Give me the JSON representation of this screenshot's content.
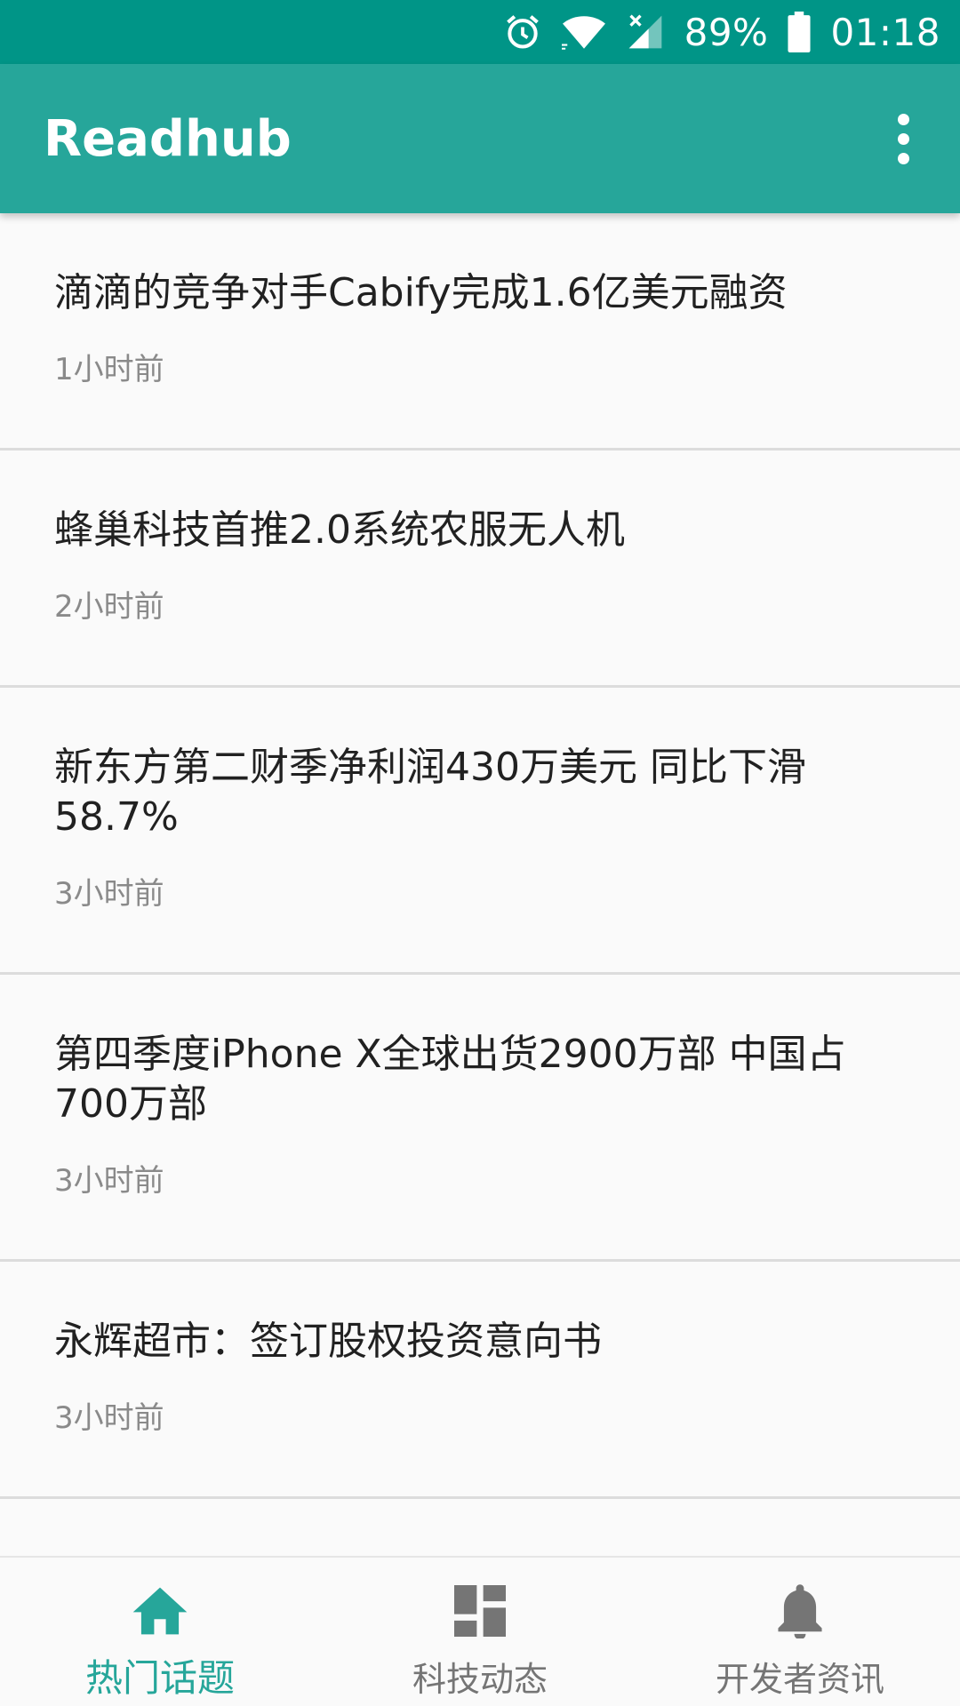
{
  "colors": {
    "status_bar": "#009587",
    "app_bar": "#26a69a",
    "accent": "#26a69a",
    "inactive": "#757575"
  },
  "status_bar": {
    "icons": [
      "alarm-icon",
      "wifi-icon",
      "cell-signal-icon",
      "battery-icon"
    ],
    "battery": "89%",
    "time": "01:18"
  },
  "app_bar": {
    "title": "Readhub",
    "menu_icon": "overflow-menu-icon"
  },
  "feed": {
    "items": [
      {
        "title": "滴滴的竞争对手Cabify完成1.6亿美元融资",
        "time": "1小时前"
      },
      {
        "title": "蜂巢科技首推2.0系统农服无人机",
        "time": "2小时前"
      },
      {
        "title": "新东方第二财季净利润430万美元 同比下滑58.7%",
        "time": "3小时前"
      },
      {
        "title": "第四季度iPhone X全球出货2900万部 中国占700万部",
        "time": "3小时前"
      },
      {
        "title": "永辉超市：签订股权投资意向书",
        "time": "3小时前"
      }
    ]
  },
  "bottom_nav": {
    "tabs": [
      {
        "label": "热门话题",
        "icon": "home-icon",
        "active": true
      },
      {
        "label": "科技动态",
        "icon": "dashboard-icon",
        "active": false
      },
      {
        "label": "开发者资讯",
        "icon": "bell-icon",
        "active": false
      }
    ]
  }
}
